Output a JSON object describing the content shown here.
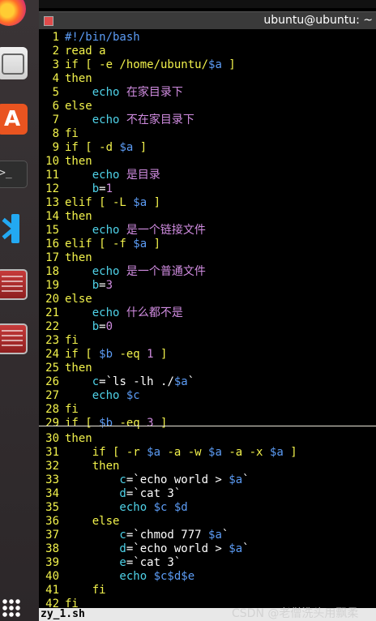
{
  "window": {
    "title": "ubuntu@ubuntu: ~"
  },
  "status": {
    "filename": "zy_1.sh"
  },
  "watermark": "CSDN @老僧洗头用飘柔",
  "colors": {
    "line_number": "#f2f24c",
    "keyword": "#f2f24c",
    "variable": "#5c9cf5",
    "special": "#4fd2e8",
    "string": "#d08ce0"
  },
  "dock": {
    "items": [
      "firefox-icon",
      "files-icon",
      "software-icon",
      "terminal-icon",
      "vscode-icon",
      "remmina-icon",
      "remmina-icon",
      "apps-grid-icon"
    ]
  },
  "editor": {
    "lines": [
      {
        "n": "1",
        "parts": [
          {
            "t": "#!/bin/bash",
            "c": "c-blue"
          }
        ]
      },
      {
        "n": "2",
        "parts": [
          {
            "t": "read a",
            "c": "kw-y"
          }
        ]
      },
      {
        "n": "3",
        "parts": [
          {
            "t": "if [ -e /home/ubuntu/",
            "c": "kw-y"
          },
          {
            "t": "$a",
            "c": "c-blue"
          },
          {
            "t": " ]",
            "c": "kw-y"
          }
        ]
      },
      {
        "n": "4",
        "parts": [
          {
            "t": "then",
            "c": "kw-y"
          }
        ]
      },
      {
        "n": "5",
        "parts": [
          {
            "t": "    echo ",
            "c": "c-cyan"
          },
          {
            "t": "在家目录下",
            "c": "c-str"
          }
        ]
      },
      {
        "n": "6",
        "parts": [
          {
            "t": "else",
            "c": "kw-y"
          }
        ]
      },
      {
        "n": "7",
        "parts": [
          {
            "t": "    echo ",
            "c": "c-cyan"
          },
          {
            "t": "不在家目录下",
            "c": "c-str"
          }
        ]
      },
      {
        "n": "8",
        "parts": [
          {
            "t": "fi",
            "c": "kw-y"
          }
        ]
      },
      {
        "n": "9",
        "parts": [
          {
            "t": "if [ -d ",
            "c": "kw-y"
          },
          {
            "t": "$a",
            "c": "c-blue"
          },
          {
            "t": " ]",
            "c": "kw-y"
          }
        ]
      },
      {
        "n": "10",
        "parts": [
          {
            "t": "then",
            "c": "kw-y"
          }
        ]
      },
      {
        "n": "11",
        "parts": [
          {
            "t": "    echo ",
            "c": "c-cyan"
          },
          {
            "t": "是目录",
            "c": "c-str"
          }
        ]
      },
      {
        "n": "12",
        "parts": [
          {
            "t": "    b",
            "c": "c-cyan"
          },
          {
            "t": "=",
            "c": "c-txt"
          },
          {
            "t": "1",
            "c": "c-str"
          }
        ]
      },
      {
        "n": "13",
        "parts": [
          {
            "t": "elif [ -L ",
            "c": "kw-y"
          },
          {
            "t": "$a",
            "c": "c-blue"
          },
          {
            "t": " ]",
            "c": "kw-y"
          }
        ]
      },
      {
        "n": "14",
        "parts": [
          {
            "t": "then",
            "c": "kw-y"
          }
        ]
      },
      {
        "n": "15",
        "parts": [
          {
            "t": "    echo ",
            "c": "c-cyan"
          },
          {
            "t": "是一个链接文件",
            "c": "c-str"
          }
        ]
      },
      {
        "n": "16",
        "parts": [
          {
            "t": "elif [ -f ",
            "c": "kw-y"
          },
          {
            "t": "$a",
            "c": "c-blue"
          },
          {
            "t": " ]",
            "c": "kw-y"
          }
        ]
      },
      {
        "n": "17",
        "parts": [
          {
            "t": "then",
            "c": "kw-y"
          }
        ]
      },
      {
        "n": "18",
        "parts": [
          {
            "t": "    echo ",
            "c": "c-cyan"
          },
          {
            "t": "是一个普通文件",
            "c": "c-str"
          }
        ]
      },
      {
        "n": "19",
        "parts": [
          {
            "t": "    b",
            "c": "c-cyan"
          },
          {
            "t": "=",
            "c": "c-txt"
          },
          {
            "t": "3",
            "c": "c-str"
          }
        ]
      },
      {
        "n": "20",
        "parts": [
          {
            "t": "else",
            "c": "kw-y"
          }
        ]
      },
      {
        "n": "21",
        "parts": [
          {
            "t": "    echo ",
            "c": "c-cyan"
          },
          {
            "t": "什么都不是",
            "c": "c-str"
          }
        ]
      },
      {
        "n": "22",
        "parts": [
          {
            "t": "    b",
            "c": "c-cyan"
          },
          {
            "t": "=",
            "c": "c-txt"
          },
          {
            "t": "0",
            "c": "c-str"
          }
        ]
      },
      {
        "n": "23",
        "parts": [
          {
            "t": "fi",
            "c": "kw-y"
          }
        ]
      },
      {
        "n": "24",
        "parts": [
          {
            "t": "if [ ",
            "c": "kw-y"
          },
          {
            "t": "$b",
            "c": "c-blue"
          },
          {
            "t": " -eq ",
            "c": "kw-y"
          },
          {
            "t": "1",
            "c": "c-str"
          },
          {
            "t": " ]",
            "c": "kw-y"
          }
        ]
      },
      {
        "n": "25",
        "parts": [
          {
            "t": "then",
            "c": "kw-y"
          }
        ]
      },
      {
        "n": "26",
        "parts": [
          {
            "t": "    c",
            "c": "c-cyan"
          },
          {
            "t": "=`ls -lh ./",
            "c": "c-txt"
          },
          {
            "t": "$a",
            "c": "c-blue"
          },
          {
            "t": "`",
            "c": "c-txt"
          }
        ]
      },
      {
        "n": "27",
        "parts": [
          {
            "t": "    echo ",
            "c": "c-cyan"
          },
          {
            "t": "$c",
            "c": "c-blue"
          }
        ]
      },
      {
        "n": "28",
        "parts": [
          {
            "t": "fi",
            "c": "kw-y"
          }
        ]
      },
      {
        "n": "29",
        "parts": [
          {
            "t": "if [ ",
            "c": "kw-y"
          },
          {
            "t": "$b",
            "c": "c-blue"
          },
          {
            "t": " -eq ",
            "c": "kw-y"
          },
          {
            "t": "3",
            "c": "c-str"
          },
          {
            "t": " ]",
            "c": "kw-y"
          }
        ]
      },
      {
        "n": "30",
        "parts": [
          {
            "t": "then",
            "c": "kw-y"
          }
        ]
      },
      {
        "n": "31",
        "parts": [
          {
            "t": "    if [ -r ",
            "c": "kw-y"
          },
          {
            "t": "$a",
            "c": "c-blue"
          },
          {
            "t": " -a -w ",
            "c": "kw-y"
          },
          {
            "t": "$a",
            "c": "c-blue"
          },
          {
            "t": " -a -x ",
            "c": "kw-y"
          },
          {
            "t": "$a",
            "c": "c-blue"
          },
          {
            "t": " ]",
            "c": "kw-y"
          }
        ]
      },
      {
        "n": "32",
        "parts": [
          {
            "t": "    then",
            "c": "kw-y"
          }
        ]
      },
      {
        "n": "33",
        "parts": [
          {
            "t": "        c",
            "c": "c-cyan"
          },
          {
            "t": "=`echo world > ",
            "c": "c-txt"
          },
          {
            "t": "$a",
            "c": "c-blue"
          },
          {
            "t": "`",
            "c": "c-txt"
          }
        ]
      },
      {
        "n": "34",
        "parts": [
          {
            "t": "        d",
            "c": "c-cyan"
          },
          {
            "t": "=`cat 3`",
            "c": "c-txt"
          }
        ]
      },
      {
        "n": "35",
        "parts": [
          {
            "t": "        echo ",
            "c": "c-cyan"
          },
          {
            "t": "$c $d",
            "c": "c-blue"
          }
        ]
      },
      {
        "n": "36",
        "parts": [
          {
            "t": "    else",
            "c": "kw-y"
          }
        ]
      },
      {
        "n": "37",
        "parts": [
          {
            "t": "        c",
            "c": "c-cyan"
          },
          {
            "t": "=`chmod 777 ",
            "c": "c-txt"
          },
          {
            "t": "$a",
            "c": "c-blue"
          },
          {
            "t": "`",
            "c": "c-txt"
          }
        ]
      },
      {
        "n": "38",
        "parts": [
          {
            "t": "        d",
            "c": "c-cyan"
          },
          {
            "t": "=`echo world > ",
            "c": "c-txt"
          },
          {
            "t": "$a",
            "c": "c-blue"
          },
          {
            "t": "`",
            "c": "c-txt"
          }
        ]
      },
      {
        "n": "39",
        "parts": [
          {
            "t": "        e",
            "c": "c-cyan"
          },
          {
            "t": "=`cat 3`",
            "c": "c-txt"
          }
        ]
      },
      {
        "n": "40",
        "parts": [
          {
            "t": "        echo ",
            "c": "c-cyan"
          },
          {
            "t": "$c$d$e",
            "c": "c-blue"
          }
        ]
      },
      {
        "n": "41",
        "parts": [
          {
            "t": "    fi",
            "c": "kw-y"
          }
        ]
      },
      {
        "n": "42",
        "parts": [
          {
            "t": "fi",
            "c": "kw-y"
          }
        ]
      }
    ]
  }
}
